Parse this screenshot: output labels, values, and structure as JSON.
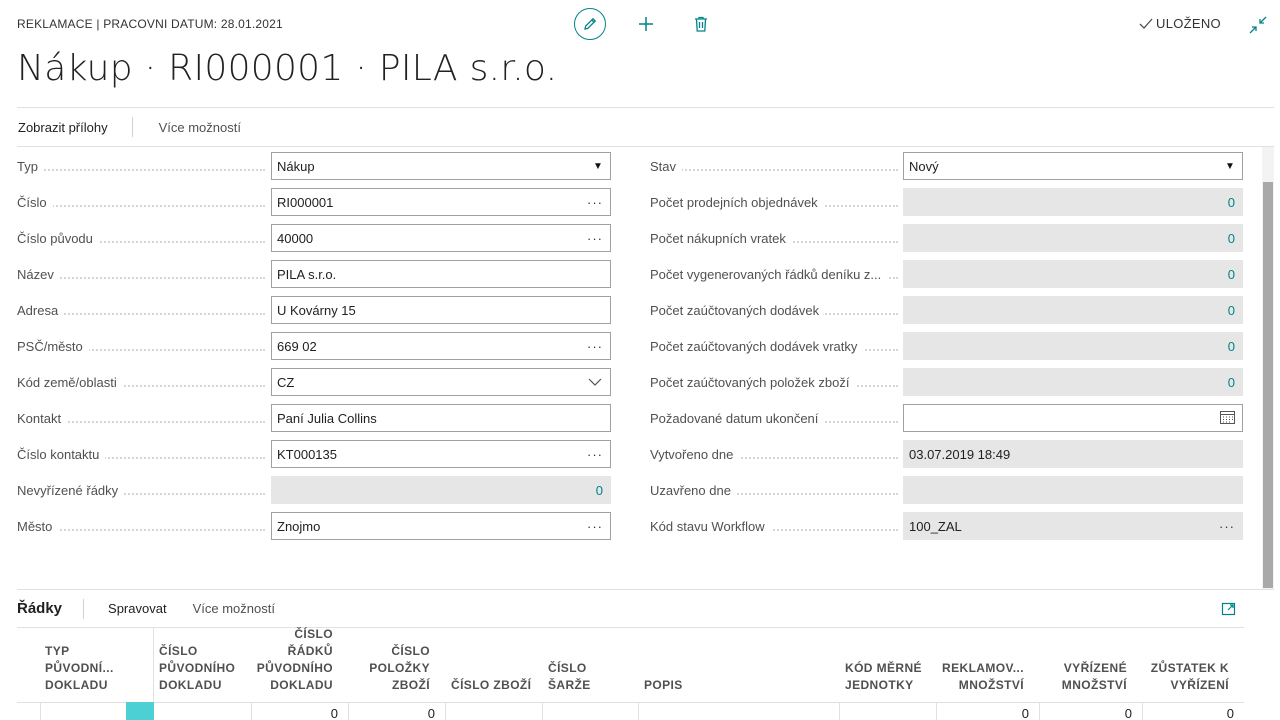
{
  "header": {
    "caption": "REKLAMACE | PRACOVNI DATUM: 28.01.2021",
    "saved_label": "ULOŽENO",
    "title": "Nákup · RI000001 · PILA s.r.o."
  },
  "actions": {
    "show_attachments": "Zobrazit přílohy",
    "more_options": "Více možností"
  },
  "left_fields": [
    {
      "label": "Typ",
      "value": "Nákup",
      "kind": "select"
    },
    {
      "label": "Číslo",
      "value": "RI000001",
      "kind": "lookup"
    },
    {
      "label": "Číslo původu",
      "value": "40000",
      "kind": "lookup"
    },
    {
      "label": "Název",
      "value": "PILA s.r.o.",
      "kind": "text"
    },
    {
      "label": "Adresa",
      "value": "U Kovárny 15",
      "kind": "text"
    },
    {
      "label": "PSČ/město",
      "value": "669 02",
      "kind": "lookup"
    },
    {
      "label": "Kód země/oblasti",
      "value": "CZ",
      "kind": "combo"
    },
    {
      "label": "Kontakt",
      "value": "Paní Julia Collins",
      "kind": "text"
    },
    {
      "label": "Číslo kontaktu",
      "value": "KT000135",
      "kind": "lookup"
    },
    {
      "label": "Nevyřízené řádky",
      "value": "0",
      "kind": "readonly-num"
    },
    {
      "label": "Město",
      "value": "Znojmo",
      "kind": "lookup"
    }
  ],
  "right_fields": [
    {
      "label": "Stav",
      "value": "Nový",
      "kind": "select"
    },
    {
      "label": "Počet prodejních objednávek",
      "value": "0",
      "kind": "readonly-num"
    },
    {
      "label": "Počet nákupních vratek",
      "value": "0",
      "kind": "readonly-num"
    },
    {
      "label": "Počet vygenerovaných řádků deníku z...",
      "value": "0",
      "kind": "readonly-num"
    },
    {
      "label": "Počet zaúčtovaných dodávek",
      "value": "0",
      "kind": "readonly-num"
    },
    {
      "label": "Počet zaúčtovaných dodávek vratky",
      "value": "0",
      "kind": "readonly-num"
    },
    {
      "label": "Počet zaúčtovaných položek zboží",
      "value": "0",
      "kind": "readonly-num"
    },
    {
      "label": "Požadované datum ukončení",
      "value": "",
      "kind": "date"
    },
    {
      "label": "Vytvořeno dne",
      "value": "03.07.2019 18:49",
      "kind": "readonly"
    },
    {
      "label": "Uzavřeno dne",
      "value": "",
      "kind": "readonly"
    },
    {
      "label": "Kód stavu Workflow",
      "value": "100_ZAL",
      "kind": "readonly-lookup"
    }
  ],
  "lines": {
    "title": "Řádky",
    "manage": "Spravovat",
    "more_options": "Více možností",
    "columns": [
      [
        "TYP",
        "PŮVODNÍ...",
        "DOKLADU"
      ],
      [
        "ČÍSLO",
        "PŮVODNÍHO",
        "DOKLADU"
      ],
      [
        "ČÍSLO",
        "ŘÁDKŮ",
        "PŮVODNÍHO",
        "DOKLADU"
      ],
      [
        "ČÍSLO",
        "POLOŽKY",
        "ZBOŽÍ"
      ],
      [
        "ČÍSLO ZBOŽÍ"
      ],
      [
        "ČÍSLO",
        "ŠARŽE"
      ],
      [
        "POPIS"
      ],
      [
        "KÓD MĚRNÉ",
        "JEDNOTKY"
      ],
      [
        "REKLAMOV...",
        "MNOŽSTVÍ"
      ],
      [
        "VYŘÍZENÉ",
        "MNOŽSTVÍ"
      ],
      [
        "ZŮSTATEK K",
        "VYŘÍZENÍ"
      ]
    ],
    "row": [
      "",
      "",
      "0",
      "0",
      "",
      "",
      "",
      "",
      "0",
      "0",
      "0"
    ]
  },
  "colors": {
    "accent": "#008489",
    "readonly_bg": "#e6e6e6",
    "selected_cell": "#4dd0d4"
  }
}
